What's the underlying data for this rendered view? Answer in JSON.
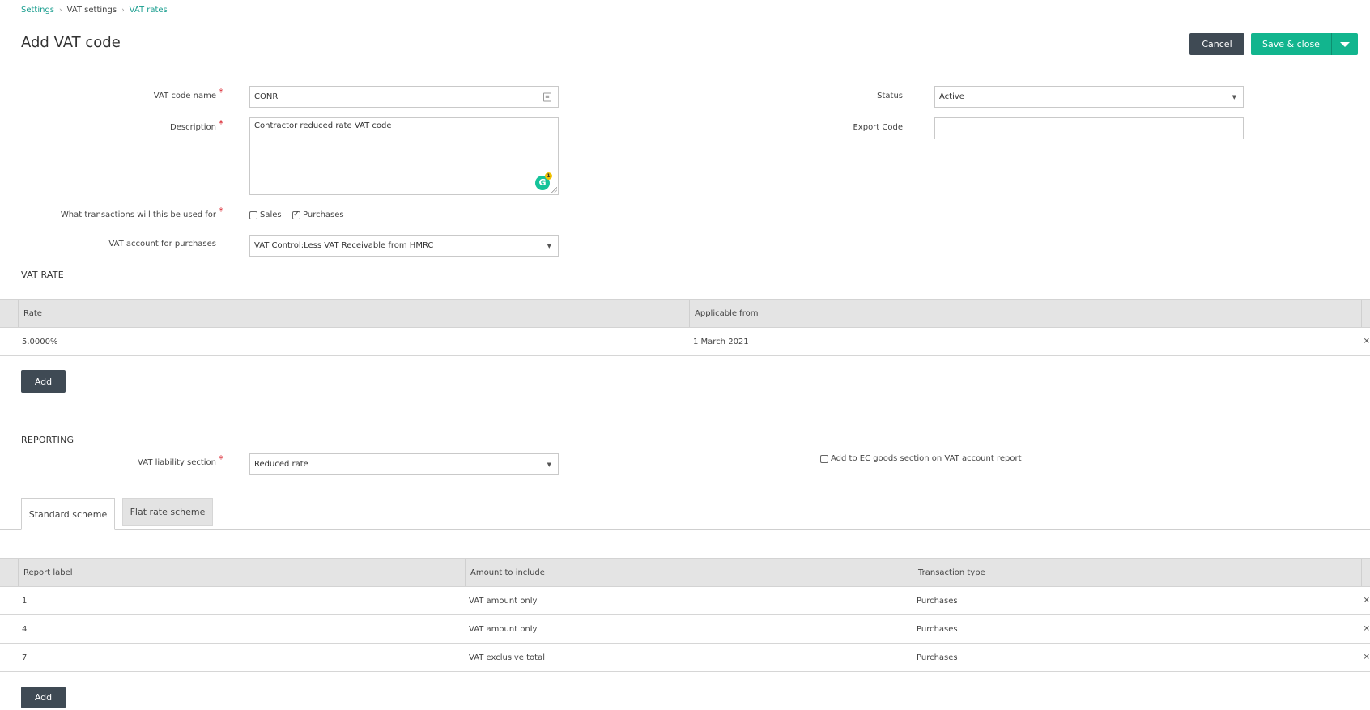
{
  "breadcrumb": {
    "items": [
      "Settings",
      "VAT settings",
      "VAT rates"
    ]
  },
  "page": {
    "title": "Add VAT code"
  },
  "actions": {
    "cancel": "Cancel",
    "save_close": "Save & close"
  },
  "form": {
    "vat_code_name_label": "VAT code name",
    "vat_code_name_value": "CONR",
    "description_label": "Description",
    "description_value": "Contractor reduced rate VAT code",
    "grammarly_count": "1",
    "transactions_label": "What transactions will this be used for",
    "sales_label": "Sales",
    "sales_checked": false,
    "purchases_label": "Purchases",
    "purchases_checked": true,
    "vat_account_label": "VAT account for purchases",
    "vat_account_value": "VAT Control:Less VAT Receivable from HMRC",
    "status_label": "Status",
    "status_value": "Active",
    "export_code_label": "Export Code",
    "export_code_value": ""
  },
  "vat_rate": {
    "heading": "VAT RATE",
    "columns": [
      "Rate",
      "Applicable from"
    ],
    "rows": [
      {
        "rate": "5.0000%",
        "applicable_from": "1 March 2021"
      }
    ],
    "add_label": "Add"
  },
  "reporting": {
    "heading": "REPORTING",
    "liability_label": "VAT liability section",
    "liability_value": "Reduced rate",
    "ec_goods_label": "Add to EC goods section on VAT account report",
    "ec_goods_checked": false,
    "tabs": [
      "Standard scheme",
      "Flat rate scheme"
    ],
    "active_tab": "Standard scheme",
    "columns": [
      "Report label",
      "Amount to include",
      "Transaction type"
    ],
    "rows": [
      {
        "label": "1",
        "amount": "VAT amount only",
        "type": "Purchases"
      },
      {
        "label": "4",
        "amount": "VAT amount only",
        "type": "Purchases"
      },
      {
        "label": "7",
        "amount": "VAT exclusive total",
        "type": "Purchases"
      }
    ],
    "add_label": "Add"
  },
  "colors": {
    "accent": "#12b58e",
    "dark_button": "#3f4a54",
    "required": "#d9232e",
    "link": "#1a9e8f"
  }
}
